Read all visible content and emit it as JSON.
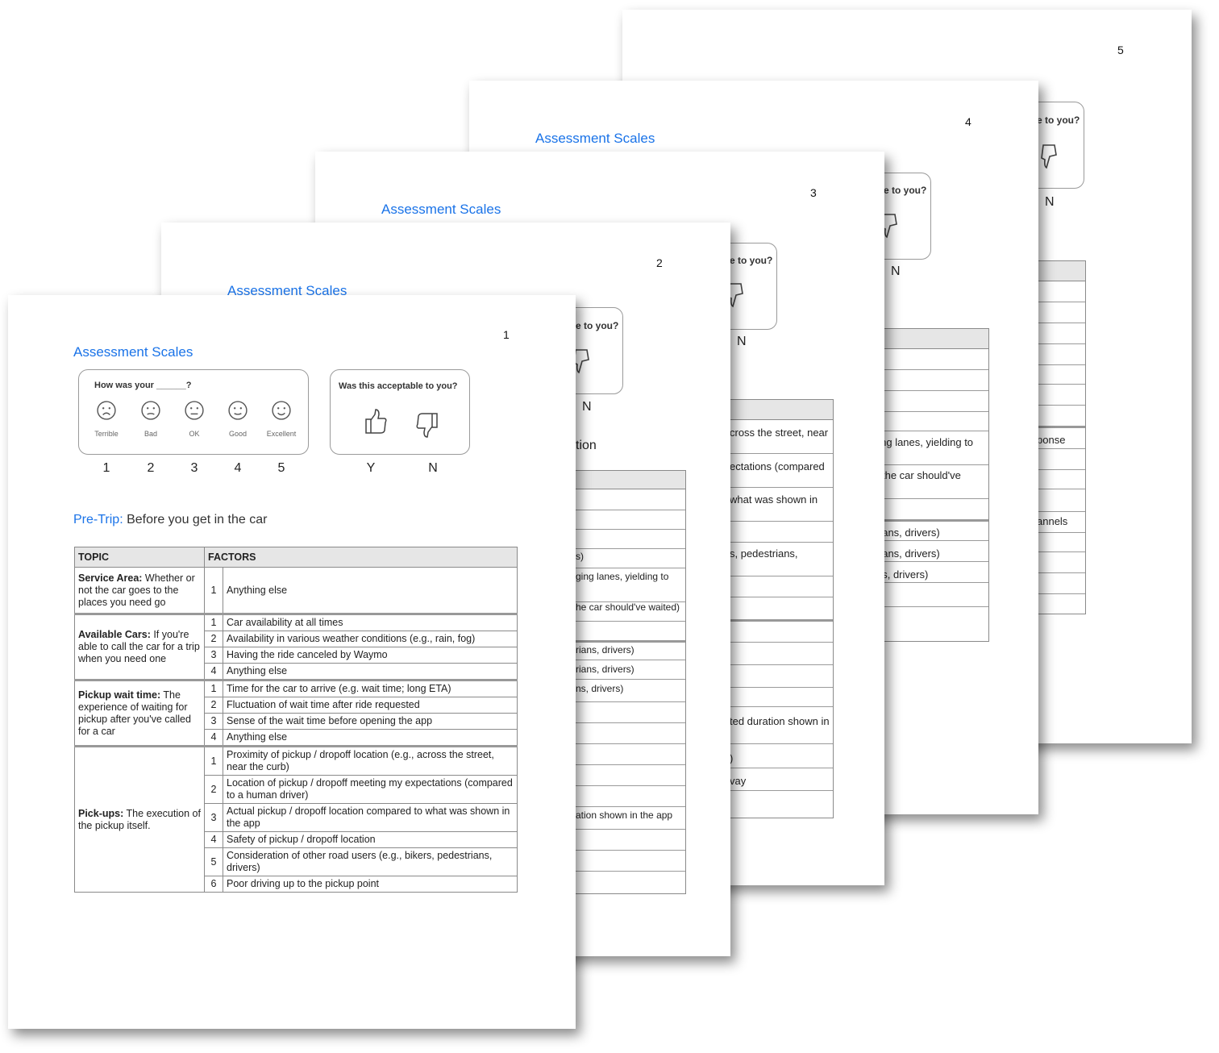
{
  "pages": [
    {
      "number": "5",
      "title": "",
      "card_question_fragment": "e to you?",
      "n_label": "N",
      "fragments": [
        "ponse",
        "annels"
      ]
    },
    {
      "number": "4",
      "title": "Assessment Scales",
      "card_question_fragment": "e to you?",
      "n_label": "N",
      "fragments": [
        "s)",
        "ging lanes, yielding to",
        "the car should've",
        "rians, drivers)",
        "rians, drivers)",
        "ns, drivers)"
      ]
    },
    {
      "number": "3",
      "title": "Assessment Scales",
      "card_question_fragment": "e to you?",
      "n_label": "N",
      "fragments": [
        "cross the street, near",
        "ectations (compared",
        "what was shown in",
        "s, pedestrians,",
        "ted duration shown in",
        ")",
        "vay"
      ]
    },
    {
      "number": "2",
      "title": "Assessment Scales",
      "card_question_fragment": "e to you?",
      "n_label": "N",
      "fragments": [
        "tion",
        "s)",
        "ging lanes, yielding to",
        "he car should've waited)",
        "rians, drivers)",
        "rians, drivers)",
        "ns, drivers)",
        "ation shown in the app"
      ]
    }
  ],
  "front": {
    "page_number": "1",
    "title": "Assessment Scales",
    "rating_card": {
      "question": "How was your ______?",
      "faces": [
        {
          "label": "Terrible",
          "mood": "frown-icon"
        },
        {
          "label": "Bad",
          "mood": "slight-frown-icon"
        },
        {
          "label": "OK",
          "mood": "neutral-icon"
        },
        {
          "label": "Good",
          "mood": "slight-smile-icon"
        },
        {
          "label": "Excellent",
          "mood": "smile-icon"
        }
      ],
      "numbers": [
        "1",
        "2",
        "3",
        "4",
        "5"
      ]
    },
    "accept_card": {
      "question": "Was this acceptable to you?",
      "yes": "Y",
      "no": "N"
    },
    "section": {
      "label": "Pre-Trip:",
      "text": " Before you get in the car"
    },
    "table": {
      "headers": [
        "TOPIC",
        "FACTORS"
      ],
      "groups": [
        {
          "topic_bold": "Service Area:",
          "topic_rest": " Whether or not the car goes to the places you need go",
          "factors": [
            {
              "n": "1",
              "t": "Anything else"
            }
          ]
        },
        {
          "topic_bold": "Available Cars:",
          "topic_rest": " If you're able to call the car for a trip when you need one",
          "factors": [
            {
              "n": "1",
              "t": "Car availability at all times"
            },
            {
              "n": "2",
              "t": "Availability in various weather conditions (e.g., rain, fog)"
            },
            {
              "n": "3",
              "t": "Having the ride canceled by Waymo"
            },
            {
              "n": "4",
              "t": "Anything else"
            }
          ]
        },
        {
          "topic_bold": "Pickup wait time:",
          "topic_rest": " The experience of waiting for pickup after you've called for a car",
          "factors": [
            {
              "n": "1",
              "t": "Time for the car to arrive (e.g. wait time; long ETA)"
            },
            {
              "n": "2",
              "t": "Fluctuation of wait time after ride requested"
            },
            {
              "n": "3",
              "t": "Sense of the wait time before opening the app"
            },
            {
              "n": "4",
              "t": "Anything else"
            }
          ]
        },
        {
          "topic_bold": "Pick-ups:",
          "topic_rest": " The execution of the pickup itself.",
          "factors": [
            {
              "n": "1",
              "t": "Proximity of pickup / dropoff location (e.g., across the street, near the curb)"
            },
            {
              "n": "2",
              "t": "Location of pickup / dropoff meeting my expectations (compared to a human driver)"
            },
            {
              "n": "3",
              "t": "Actual pickup / dropoff location compared to what was shown in the app"
            },
            {
              "n": "4",
              "t": "Safety of pickup / dropoff location"
            },
            {
              "n": "5",
              "t": "Consideration of other road users (e.g., bikers, pedestrians, drivers)"
            },
            {
              "n": "6",
              "t": "Poor driving up to the pickup point"
            }
          ]
        }
      ]
    }
  }
}
